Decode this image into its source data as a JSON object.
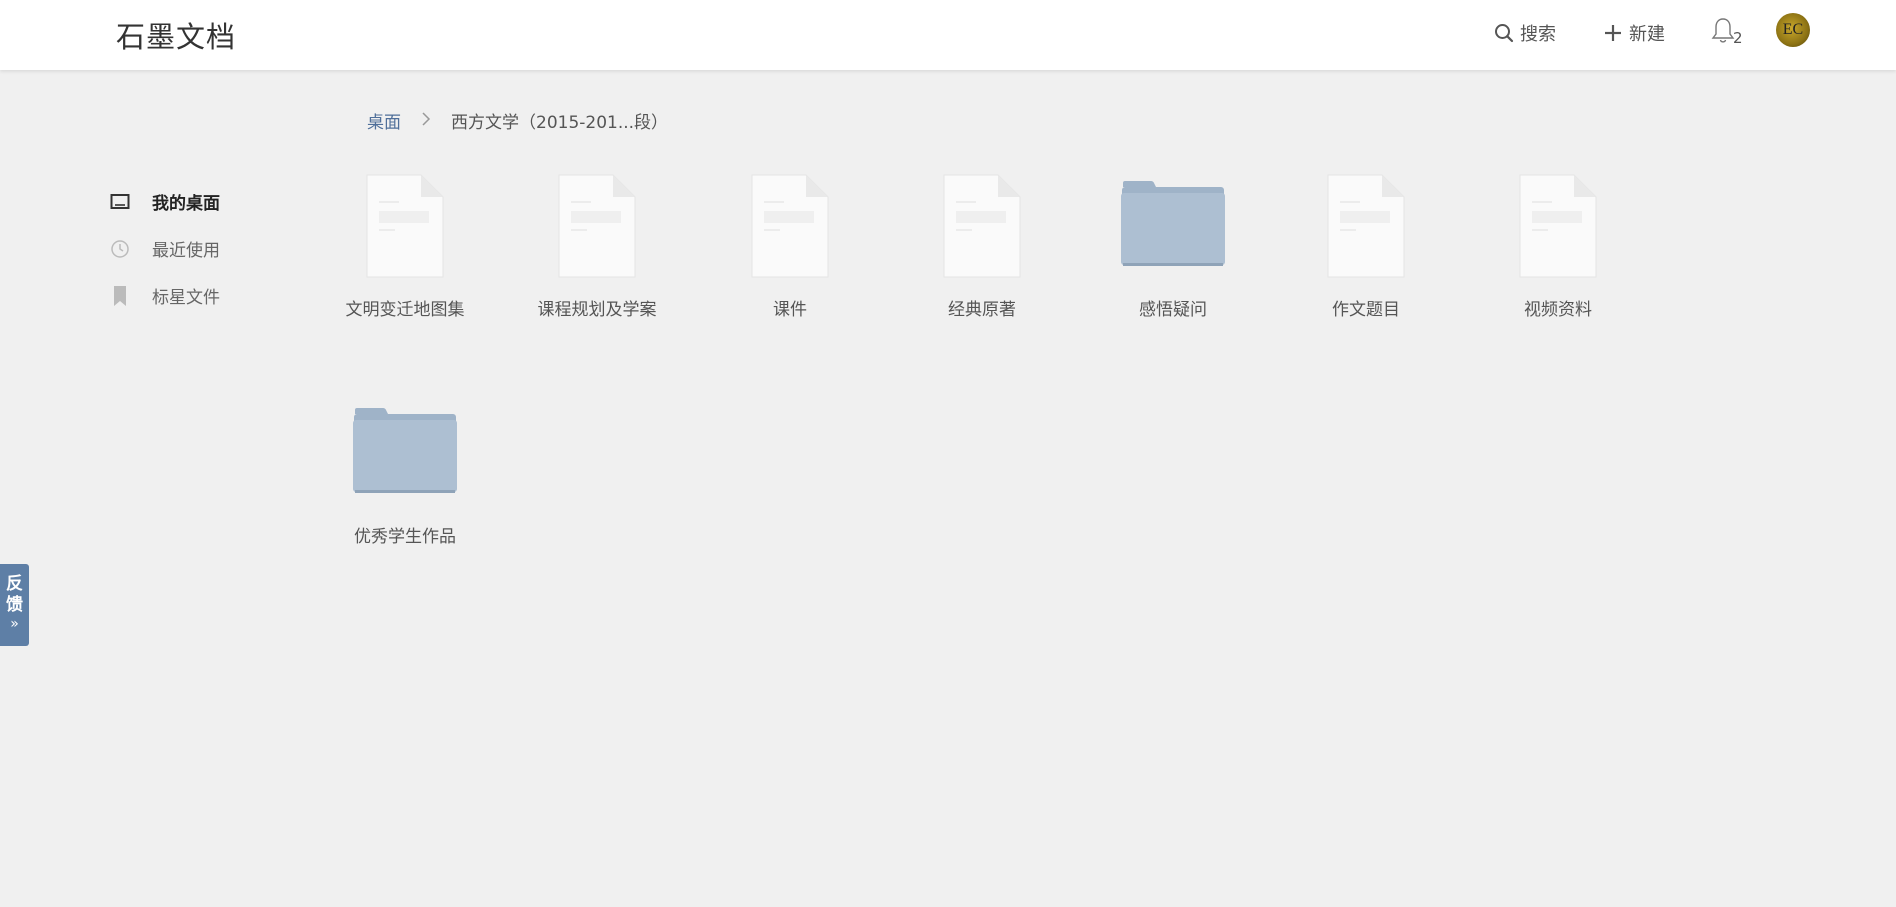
{
  "header": {
    "logo": "石墨文档",
    "search_label": "搜索",
    "new_label": "新建",
    "notification_count": "2",
    "avatar_initials": "EC"
  },
  "breadcrumb": {
    "root": "桌面",
    "current": "西方文学（2015-201...段）"
  },
  "sidebar": {
    "items": [
      {
        "label": "我的桌面",
        "icon": "desktop-icon",
        "active": true
      },
      {
        "label": "最近使用",
        "icon": "clock-icon",
        "active": false
      },
      {
        "label": "标星文件",
        "icon": "bookmark-icon",
        "active": false
      }
    ]
  },
  "files": [
    {
      "name": "文明变迁地图集",
      "type": "document"
    },
    {
      "name": "课程规划及学案",
      "type": "document"
    },
    {
      "name": "课件",
      "type": "document"
    },
    {
      "name": "经典原著",
      "type": "document"
    },
    {
      "name": "感悟疑问",
      "type": "folder"
    },
    {
      "name": "作文题目",
      "type": "document"
    },
    {
      "name": "视频资料",
      "type": "document"
    },
    {
      "name": "优秀学生作品",
      "type": "folder"
    }
  ],
  "feedback": {
    "label": "反馈",
    "arrow": "»"
  },
  "colors": {
    "accent": "#4f6f9a",
    "folder": "#a9bcd0",
    "feedback_bg": "#5e7fa6",
    "background": "#f0f0f0"
  }
}
